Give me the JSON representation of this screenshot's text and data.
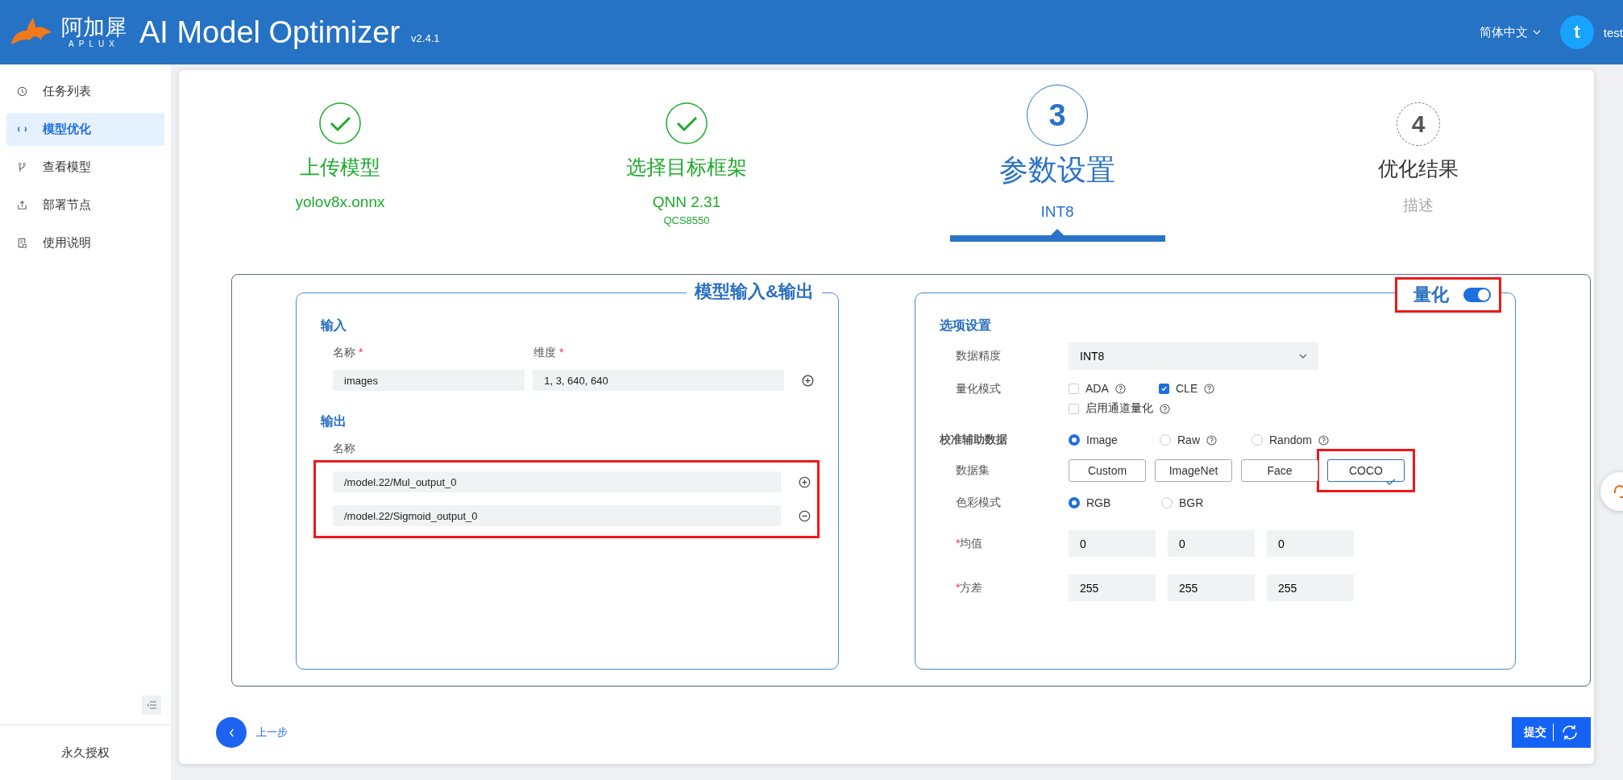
{
  "header": {
    "brand_cn": "阿加犀",
    "brand_en": "APLUX",
    "title": "AI Model Optimizer",
    "version": "v2.4.1",
    "language": "简体中文",
    "avatar_letter": "t",
    "username": "test"
  },
  "sidebar": {
    "items": [
      {
        "label": "任务列表",
        "selected": false
      },
      {
        "label": "模型优化",
        "selected": true
      },
      {
        "label": "查看模型",
        "selected": false
      },
      {
        "label": "部署节点",
        "selected": false
      },
      {
        "label": "使用说明",
        "selected": false
      }
    ],
    "footer": "永久授权"
  },
  "steps": [
    {
      "kind": "done",
      "title": "上传模型",
      "subtitle": "yolov8x.onnx"
    },
    {
      "kind": "done",
      "title": "选择目标框架",
      "subtitle": "QNN 2.31",
      "note": "QCS8550"
    },
    {
      "kind": "current",
      "number": "3",
      "title": "参数设置",
      "subtitle": "INT8"
    },
    {
      "kind": "pending",
      "number": "4",
      "title": "优化结果",
      "subtitle": "描述"
    }
  ],
  "io_panel": {
    "title": "模型输入&输出",
    "input_heading": "输入",
    "input_labels": [
      {
        "text": "名称",
        "mark": "*"
      },
      {
        "text": "维度",
        "mark": "*"
      }
    ],
    "inputs": [
      {
        "name": "images",
        "dims": "1, 3, 640, 640",
        "kind": "add"
      }
    ],
    "output_heading": "输出",
    "output_label": "名称",
    "outputs_highlighted": true,
    "outputs": [
      {
        "value": "/model.22/Mul_output_0",
        "kind": "add"
      },
      {
        "value": "/model.22/Sigmoid_output_0",
        "kind": "remove"
      }
    ]
  },
  "quant_panel": {
    "title": "量化",
    "on": true,
    "highlighted": true,
    "options_heading": "选项设置",
    "precision_label": "数据精度",
    "precision_value": "INT8",
    "mode_label": "量化模式",
    "modes": [
      {
        "label": "ADA",
        "checked": false,
        "help": true
      },
      {
        "label": "CLE",
        "checked": true,
        "help": true
      },
      {
        "label": "启用通道量化",
        "checked": false,
        "help": true
      }
    ],
    "calib_heading": "校准辅助数据",
    "calib_types": [
      {
        "label": "Image",
        "selected": true,
        "help": false
      },
      {
        "label": "Raw",
        "selected": false,
        "help": true
      },
      {
        "label": "Random",
        "selected": false,
        "help": true
      }
    ],
    "dataset_label": "数据集",
    "datasets": [
      {
        "label": "Custom",
        "selected": false,
        "highlighted": false
      },
      {
        "label": "ImageNet",
        "selected": false,
        "highlighted": false
      },
      {
        "label": "Face",
        "selected": false,
        "highlighted": false
      },
      {
        "label": "COCO",
        "selected": true,
        "highlighted": true
      }
    ],
    "color_label": "色彩模式",
    "color_modes": [
      {
        "label": "RGB",
        "selected": true
      },
      {
        "label": "BGR",
        "selected": false
      }
    ],
    "mean_label": {
      "text": "均值",
      "mark": "*"
    },
    "mean": [
      "0",
      "0",
      "0"
    ],
    "var_label": {
      "text": "方差",
      "mark": "*"
    },
    "var": [
      "255",
      "255",
      "255"
    ]
  },
  "footer": {
    "back": "上一步",
    "submit": "提交"
  }
}
